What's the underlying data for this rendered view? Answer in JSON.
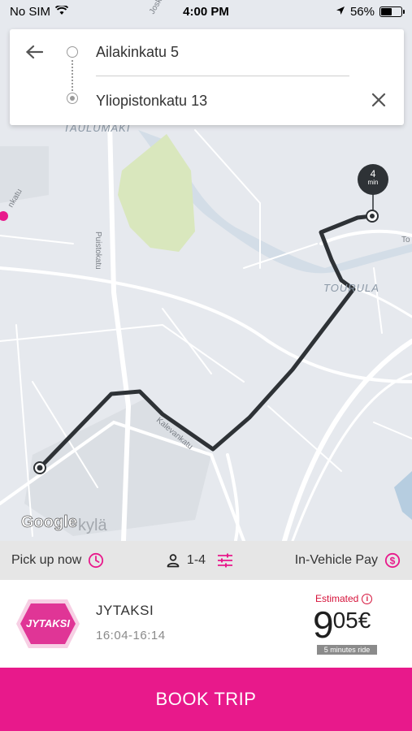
{
  "status_bar": {
    "carrier": "No SIM",
    "time": "4:00 PM",
    "battery_percent": "56%",
    "battery_level": 0.56,
    "icons": [
      "wifi-icon",
      "location-arrow-icon",
      "battery-icon"
    ]
  },
  "route": {
    "origin": "Ailakinkatu 5",
    "destination": "Yliopistonkatu 13",
    "icons": [
      "back-arrow-icon",
      "clear-icon"
    ]
  },
  "map": {
    "district_labels": [
      "TAULUMAKI",
      "TOURULA"
    ],
    "street_labels": [
      "Puistokatu",
      "Kalevankatu",
      "Joskentie",
      "nkatu",
      "To"
    ],
    "eta_value": "4",
    "eta_unit": "min",
    "attribution": "Google",
    "city_label": "kylä",
    "colors": {
      "route": "#2e3236",
      "park": "#d8e8b9",
      "water": "#b6d0e2",
      "road": "#ffffff"
    }
  },
  "options": {
    "pickup_label": "Pick up now",
    "passengers_label": "1-4",
    "payment_label": "In-Vehicle Pay",
    "icons": [
      "clock-icon",
      "person-icon",
      "filter-sliders-icon",
      "dollar-circle-icon"
    ],
    "accent_color": "#e8198b"
  },
  "offer": {
    "logo_text": "JYTAKSI",
    "provider_name": "JYTAKSI",
    "time_window": "16:04-16:14",
    "estimated_label": "Estimated",
    "price_integer": "9",
    "price_decimal": "05€",
    "ride_duration": "5 minutes ride",
    "colors": {
      "estimated": "#d6123a",
      "logo": "#e03596"
    }
  },
  "book_button": {
    "label": "BOOK TRIP",
    "color": "#e8198b"
  }
}
